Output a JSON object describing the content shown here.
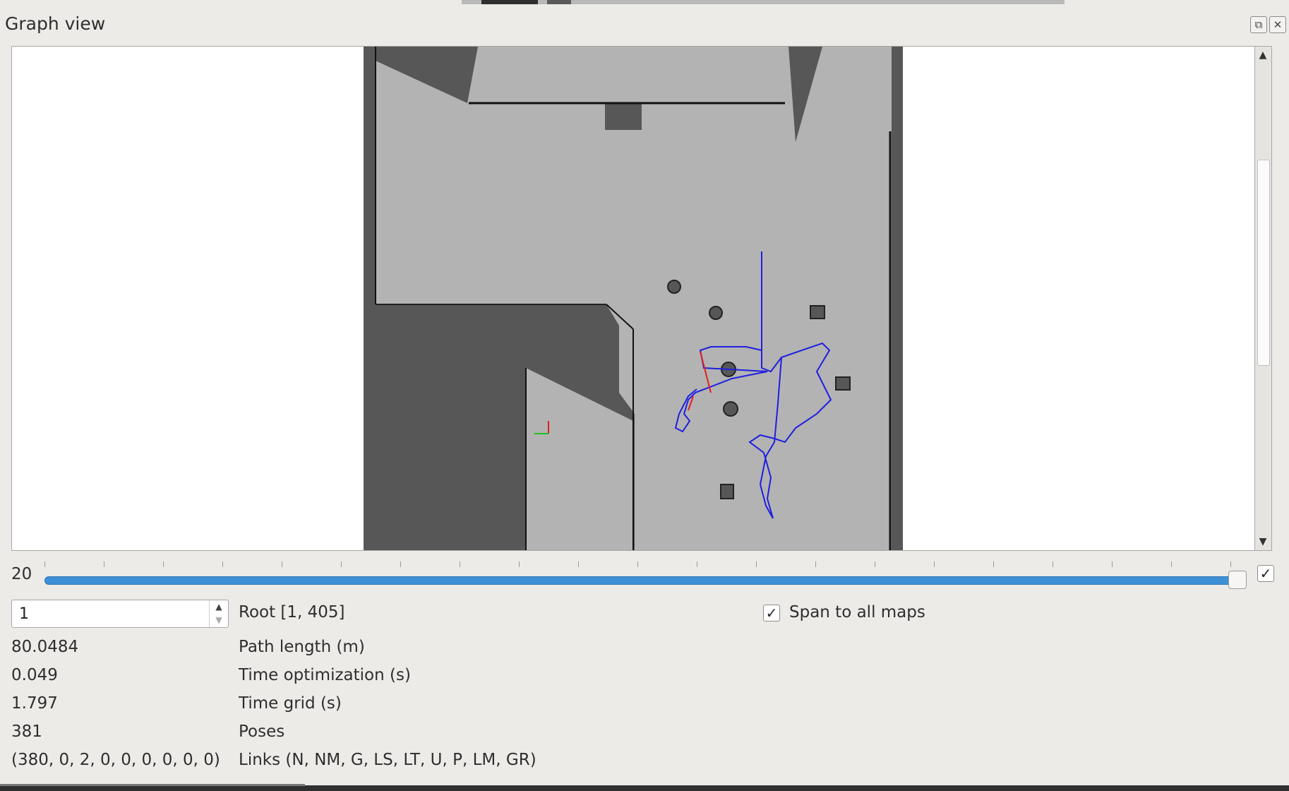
{
  "window": {
    "title": "Graph view"
  },
  "slider": {
    "value": "20",
    "progress_fraction": 0.99
  },
  "root_selector": {
    "value": "1",
    "label": "Root [1, 405]"
  },
  "span_option": {
    "checked": true,
    "label": "Span to all maps"
  },
  "stats": {
    "path_length_value": "80.0484",
    "path_length_label": "Path length (m)",
    "time_opt_value": "0.049",
    "time_opt_label": "Time optimization (s)",
    "time_grid_value": "1.797",
    "time_grid_label": "Time grid (s)",
    "poses_value": "381",
    "poses_label": "Poses",
    "links_value": "(380, 0, 2, 0, 0, 0, 0, 0, 0)",
    "links_label": "Links (N, NM, G, LS, LT, U, P, LM, GR)"
  },
  "colors": {
    "graph_path": "#1f1fe0",
    "loop_link": "#e02020",
    "map_free": "#b3b3b3",
    "map_unknown": "#575757",
    "slider_fill": "#3d8fd6"
  },
  "icons": {
    "float_button": "float-icon",
    "close_button": "close-icon",
    "scroll_up": "arrow-up-icon",
    "scroll_down": "arrow-down-icon"
  }
}
